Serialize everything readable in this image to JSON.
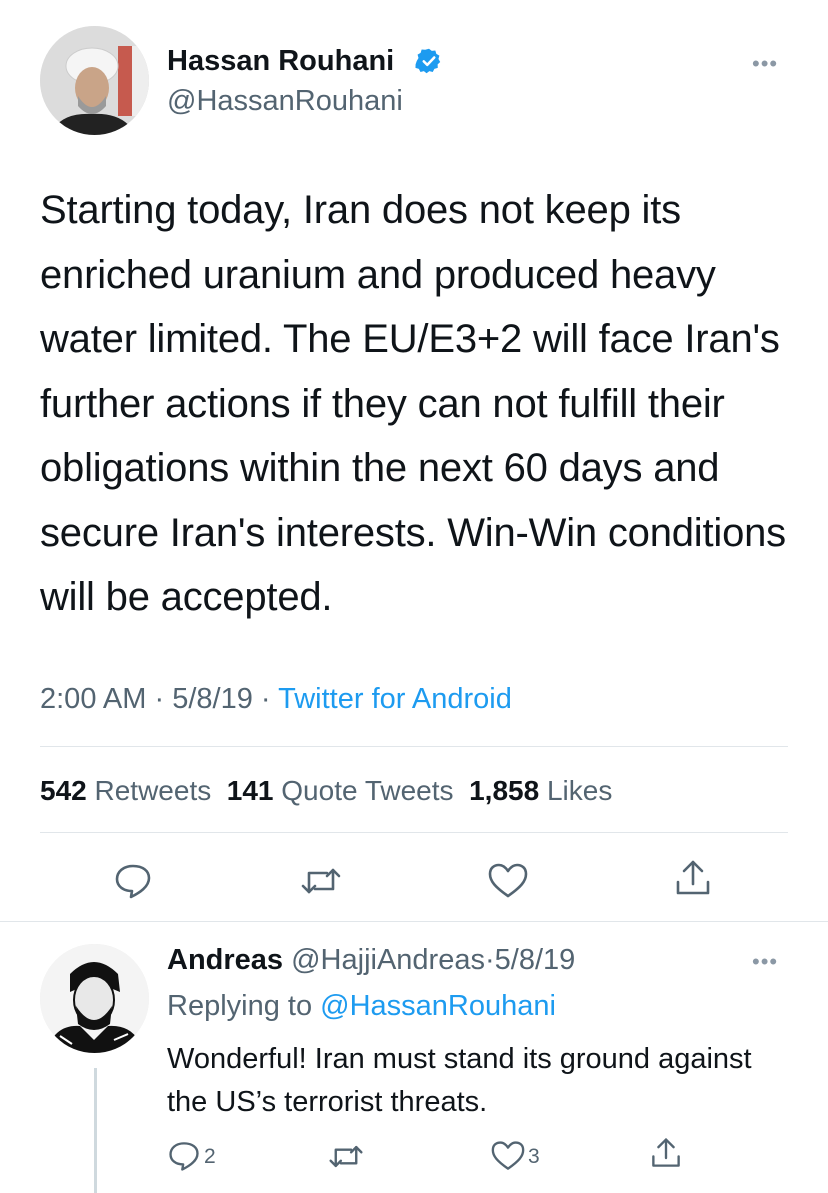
{
  "tweet": {
    "author_name": "Hassan Rouhani",
    "author_handle": "@HassanRouhani",
    "text": "Starting today, Iran does not keep its enriched uranium and produced heavy water limited. The EU/E3+2 will face Iran's further actions if they can not fulfill their obligations within the next 60 days and secure Iran's interests. Win-Win conditions will be accepted.",
    "time": "2:00 AM",
    "date": "5/8/19",
    "separator": "·",
    "source": "Twitter for Android",
    "stats": {
      "retweets_count": "542",
      "retweets_label": "Retweets",
      "quotes_count": "141",
      "quotes_label": "Quote Tweets",
      "likes_count": "1,858",
      "likes_label": "Likes"
    }
  },
  "reply": {
    "author_name": "Andreas",
    "author_handle": "@HajjiAndreas",
    "separator": "·",
    "date": "5/8/19",
    "replying_prefix": "Replying to",
    "replying_to": "@HassanRouhani",
    "text": "Wonderful! Iran must stand its ground against the US’s terrorist threats.",
    "reply_count": "2",
    "like_count": "3"
  },
  "icons": {
    "verified": "verified-badge-icon",
    "more": "more-dots-icon",
    "reply": "reply-bubble-icon",
    "retweet": "retweet-icon",
    "like": "heart-icon",
    "share": "share-icon"
  },
  "colors": {
    "accent": "#1d9bf0",
    "text": "#0f1419",
    "secondary": "#536471",
    "divider": "#e1e6ea"
  }
}
